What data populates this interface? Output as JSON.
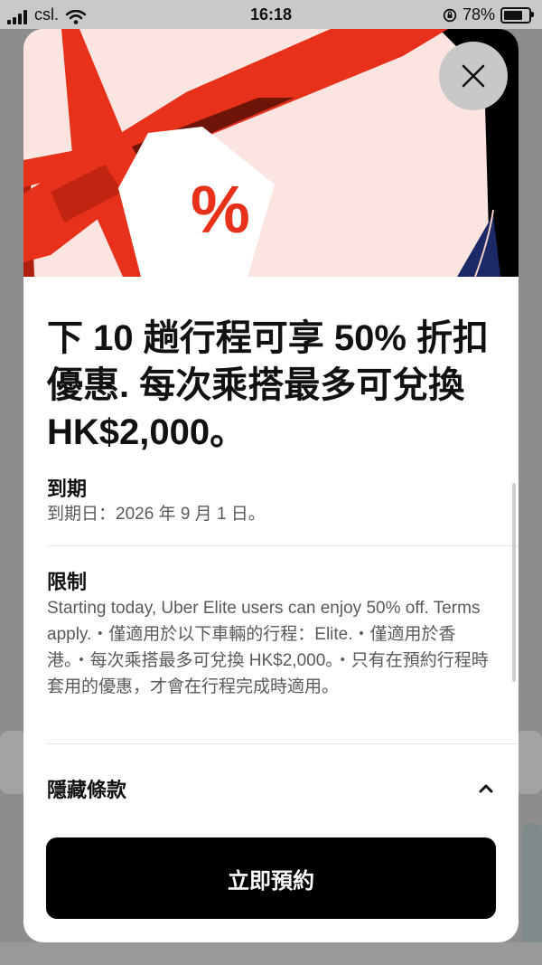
{
  "status_bar": {
    "carrier": "csl.",
    "time": "16:18",
    "battery": "78%",
    "battery_level": 0.78
  },
  "promo": {
    "title": "下 10 趟行程可享 50% 折扣優惠. 每次乘搭最多可兌換 HK$2,000。",
    "hero_tag_symbol": "%",
    "expiry": {
      "heading": "到期",
      "text": "到期日：2026 年 9 月 1 日。"
    },
    "restrictions": {
      "heading": "限制",
      "text": "Starting today, Uber Elite users can enjoy 50% off. Terms apply.・僅適用於以下車輛的行程：Elite.・僅適用於香港。・每次乘搭最多可兌換 HK$2,000。・只有在預約行程時套用的優惠，才會在行程完成時適用。"
    },
    "toggle_label": "隱藏條款",
    "cta_label": "立即預約"
  },
  "colors": {
    "ribbon": "#e8311a",
    "card": "#fce4e1",
    "cta": "#000000"
  },
  "icons": {
    "close": "close-icon",
    "chevron": "chevron-up-icon",
    "wifi": "wifi-icon",
    "lock": "rotation-lock-icon"
  }
}
